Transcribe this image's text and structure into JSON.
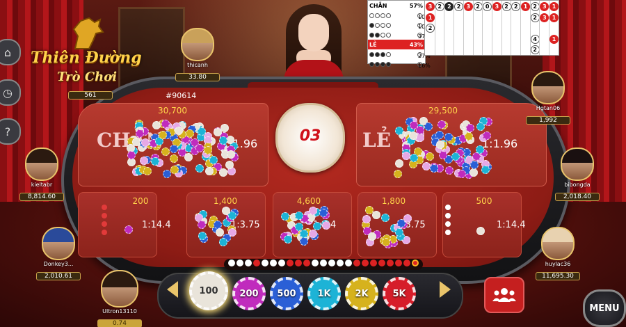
{
  "logo": {
    "line1": "Thiên Đường",
    "line2": "Trò Chơi"
  },
  "round": {
    "id": "#90614",
    "result": "03"
  },
  "main_bets": {
    "chan": {
      "label": "CHẴN",
      "odds": "1:1.96",
      "total": "30,700"
    },
    "le": {
      "label": "LẺ",
      "odds": "1:1.96",
      "total": "29,500"
    }
  },
  "sub_bets": [
    {
      "total": "200",
      "odds": "1:14.4"
    },
    {
      "total": "1,400",
      "odds": "1:3.75"
    },
    {
      "total": "4,600",
      "odds": "1:2.4"
    },
    {
      "total": "1,800",
      "odds": "1:3.75"
    },
    {
      "total": "500",
      "odds": "1:14.4"
    }
  ],
  "players": [
    {
      "name": "thicanh",
      "balance": "33.80"
    },
    {
      "name": "Hgtan06",
      "balance": "1,992"
    },
    {
      "name": "kieltabr",
      "balance": "8,814.60"
    },
    {
      "name": "bibongda",
      "balance": "2,018.40"
    },
    {
      "name": "Donkey3...",
      "balance": "2,010.61"
    },
    {
      "name": "huylac36",
      "balance": "11,695.30"
    },
    {
      "name": "Ultron13110",
      "balance": "0.74"
    }
  ],
  "logo_player": {
    "balance": "561"
  },
  "chips": [
    {
      "label": "100",
      "color": "#e9e4da"
    },
    {
      "label": "200",
      "color": "#c02bbd"
    },
    {
      "label": "500",
      "color": "#2a5fd6"
    },
    {
      "label": "1K",
      "color": "#1db3d6"
    },
    {
      "label": "2K",
      "color": "#d6b21d"
    },
    {
      "label": "5K",
      "color": "#d61d2a"
    }
  ],
  "stats": {
    "chan_label": "CHẴN",
    "chan_pct": "57%",
    "le_label": "LẺ",
    "le_pct": "43%",
    "rows": [
      {
        "pct": "10%"
      },
      {
        "pct": "10%"
      },
      {
        "pct": "37%"
      },
      {
        "pct": "27%"
      },
      {
        "pct": "16%"
      }
    ]
  },
  "menu": {
    "label": "MENU"
  },
  "colors": {
    "accent_gold": "#e9c46a",
    "table_red": "#9a2a20",
    "result_red": "#d0101a"
  }
}
